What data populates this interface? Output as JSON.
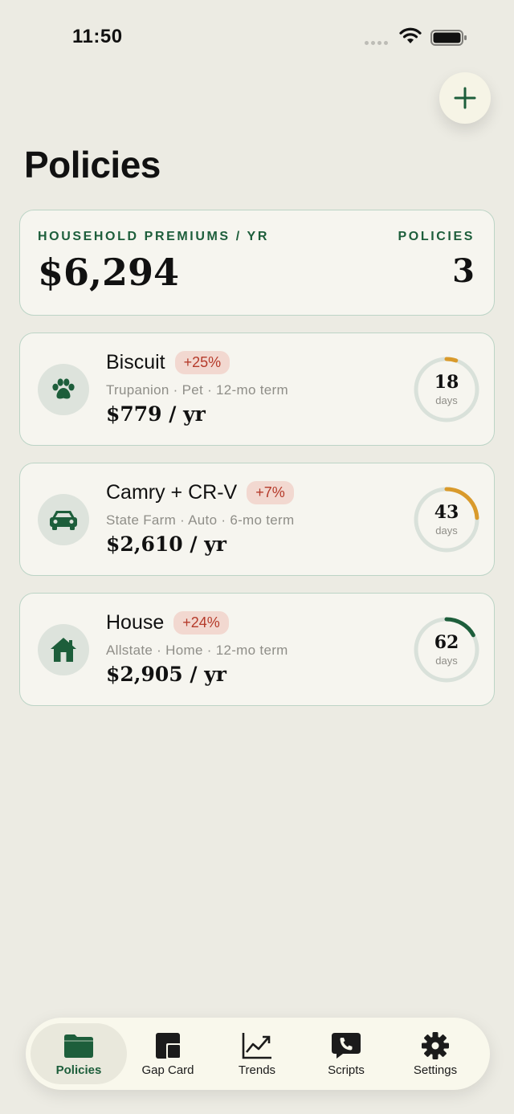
{
  "status_bar": {
    "time": "11:50"
  },
  "header": {
    "title": "Policies"
  },
  "summary": {
    "premiums_label": "HOUSEHOLD PREMIUMS / YR",
    "premiums_total": "$6,294",
    "policies_label": "POLICIES",
    "policies_count": "3"
  },
  "policies": [
    {
      "name": "Biscuit",
      "change": "+25%",
      "meta": "Trupanion · Pet · 12-mo term",
      "price": "$779 / yr",
      "days": "18",
      "days_unit": "days",
      "ring_fraction": 0.05,
      "ring_color": "#d99a2b",
      "icon": "paw-icon"
    },
    {
      "name": "Camry + CR-V",
      "change": "+7%",
      "meta": "State Farm · Auto · 6-mo term",
      "price": "$2,610 / yr",
      "days": "43",
      "days_unit": "days",
      "ring_fraction": 0.24,
      "ring_color": "#d99a2b",
      "icon": "car-icon"
    },
    {
      "name": "House",
      "change": "+24%",
      "meta": "Allstate · Home · 12-mo term",
      "price": "$2,905 / yr",
      "days": "62",
      "days_unit": "days",
      "ring_fraction": 0.17,
      "ring_color": "#1d5e3b",
      "icon": "house-icon"
    }
  ],
  "tabs": [
    {
      "label": "Policies",
      "icon": "folder-icon",
      "active": true
    },
    {
      "label": "Gap Card",
      "icon": "cards-icon",
      "active": false
    },
    {
      "label": "Trends",
      "icon": "trend-chart-icon",
      "active": false
    },
    {
      "label": "Scripts",
      "icon": "phone-bubble-icon",
      "active": false
    },
    {
      "label": "Settings",
      "icon": "gear-icon",
      "active": false
    }
  ],
  "colors": {
    "accent": "#1d5e3b",
    "background": "#ecebe3",
    "badge_bg": "#f2d8d0",
    "badge_text": "#b53a2a",
    "ring_track": "#d9e1da"
  }
}
